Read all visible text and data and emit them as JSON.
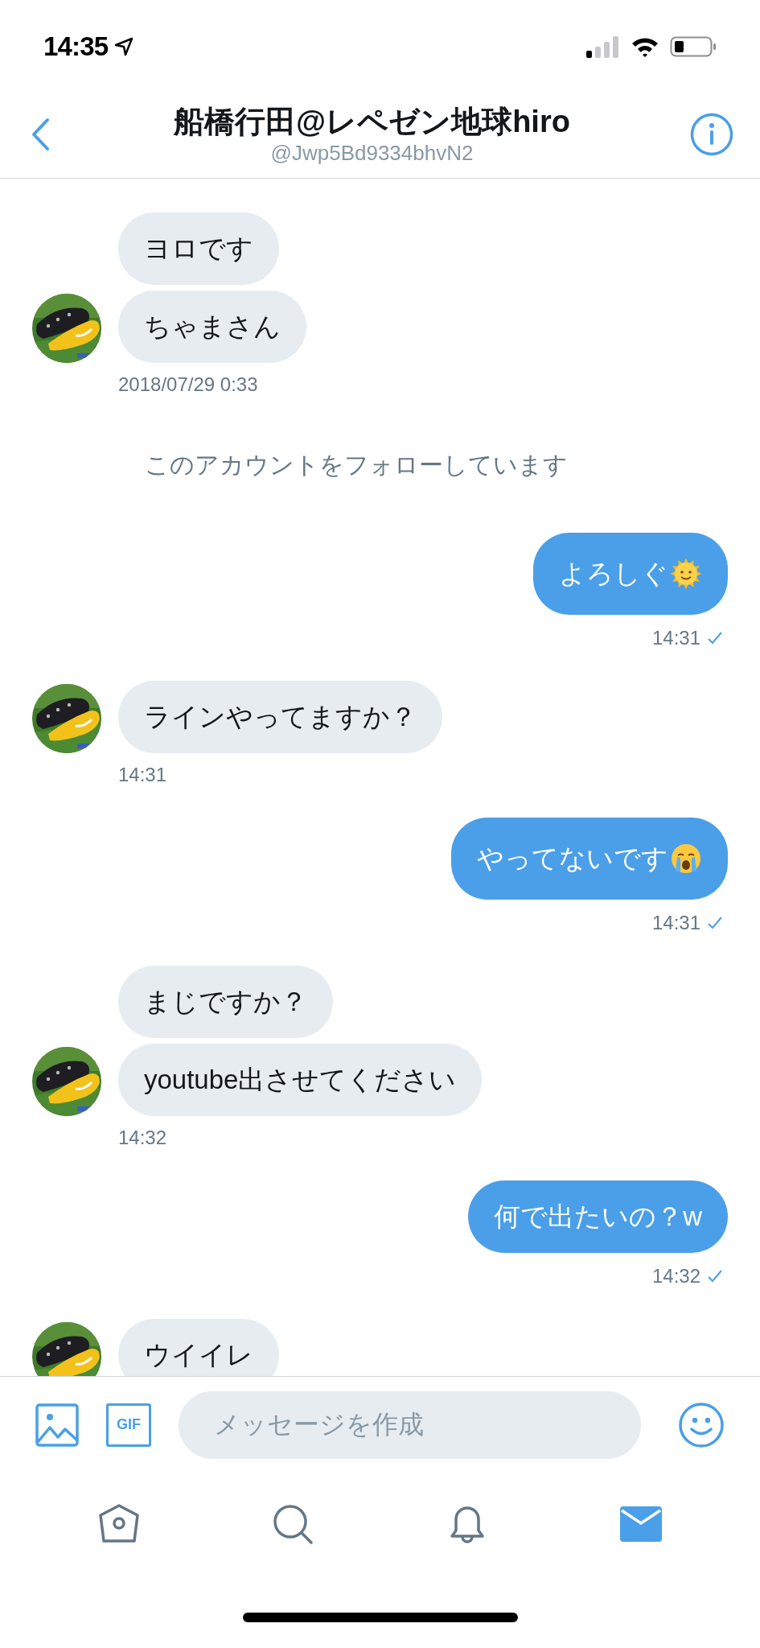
{
  "status_bar": {
    "time": "14:35"
  },
  "header": {
    "title": "船橋行田@レペゼン地球hiro",
    "handle": "@Jwp5Bd9334bhvN2"
  },
  "messages": [
    {
      "kind": "received",
      "bubbles": [
        {
          "text": "ヨロです"
        },
        {
          "text": "ちゃまさん"
        }
      ],
      "time": "2018/07/29 0:33"
    },
    {
      "kind": "notice",
      "text": "このアカウントをフォローしています"
    },
    {
      "kind": "sent",
      "bubbles": [
        {
          "text": "よろしぐ",
          "kind": "sun"
        }
      ],
      "time": "14:31",
      "read": true
    },
    {
      "kind": "received",
      "bubbles": [
        {
          "text": "ラインやってますか？"
        }
      ],
      "time": "14:31"
    },
    {
      "kind": "sent",
      "bubbles": [
        {
          "text": "やってないです",
          "kind": "crying"
        }
      ],
      "time": "14:31",
      "read": true
    },
    {
      "kind": "received",
      "bubbles": [
        {
          "text": "まじですか？"
        },
        {
          "text": "youtube出させてください"
        }
      ],
      "time": "14:32"
    },
    {
      "kind": "sent",
      "bubbles": [
        {
          "text": "何で出たいの？w"
        }
      ],
      "time": "14:32",
      "read": true
    },
    {
      "kind": "received",
      "bubbles": [
        {
          "text": "ウイイレ"
        }
      ]
    }
  ],
  "composer": {
    "gif_label": "GIF",
    "placeholder": "メッセージを作成"
  },
  "tabs": [
    {
      "kind": "home",
      "selected": false
    },
    {
      "kind": "search",
      "selected": false
    },
    {
      "kind": "notifications",
      "selected": false
    },
    {
      "kind": "messages",
      "selected": true
    }
  ]
}
